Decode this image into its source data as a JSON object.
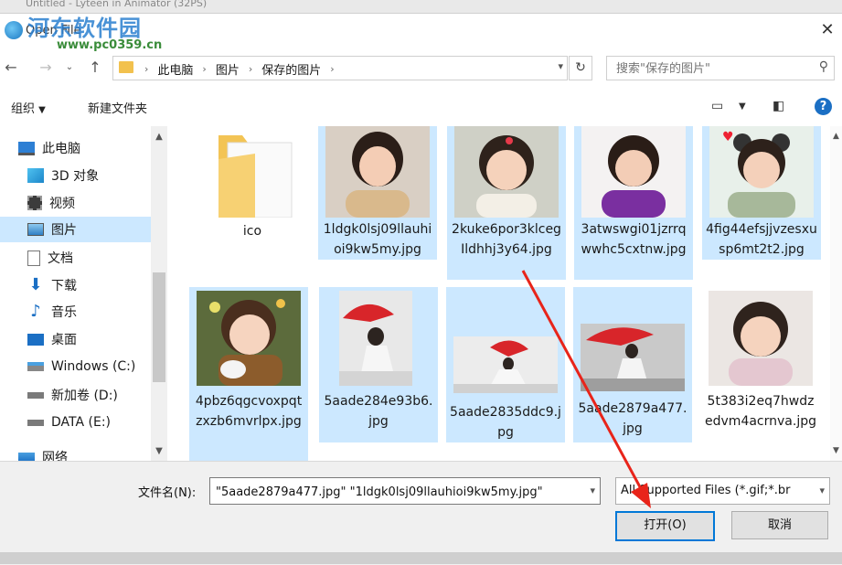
{
  "window": {
    "background_title": "Untitled - Lyteen in Animator (32PS)",
    "dialog_title": "Open File",
    "watermark": "河东软件园",
    "watermark_url": "www.pc0359.cn"
  },
  "address": {
    "crumbs": [
      "此电脑",
      "图片",
      "保存的图片"
    ],
    "search_placeholder": "搜索\"保存的图片\""
  },
  "toolbar": {
    "organize": "组织",
    "new_folder": "新建文件夹"
  },
  "sidebar": {
    "items": [
      {
        "label": "此电脑",
        "icon": "computer-icon"
      },
      {
        "label": "3D 对象",
        "icon": "cube-icon"
      },
      {
        "label": "视频",
        "icon": "video-icon"
      },
      {
        "label": "图片",
        "icon": "picture-icon",
        "selected": true
      },
      {
        "label": "文档",
        "icon": "document-icon"
      },
      {
        "label": "下载",
        "icon": "download-icon"
      },
      {
        "label": "音乐",
        "icon": "music-icon"
      },
      {
        "label": "桌面",
        "icon": "desktop-icon"
      },
      {
        "label": "Windows (C:)",
        "icon": "drive-icon"
      },
      {
        "label": "新加卷 (D:)",
        "icon": "drive-icon"
      },
      {
        "label": "DATA (E:)",
        "icon": "drive-icon"
      },
      {
        "label": "网络",
        "icon": "network-icon"
      }
    ]
  },
  "files": [
    {
      "name": "ico",
      "kind": "folder",
      "selected": false
    },
    {
      "name": "1ldgk0lsj09llauhioi9kw5my.jpg",
      "kind": "portrait",
      "selected": true
    },
    {
      "name": "2kuke6por3klcegIldhhj3y64.jpg",
      "kind": "portrait",
      "selected": true
    },
    {
      "name": "3atwswgi01jzrrqwwhc5cxtnw.jpg",
      "kind": "portrait",
      "selected": true
    },
    {
      "name": "4fig44efsjjvzesxusp6mt2t2.jpg",
      "kind": "portrait",
      "selected": true
    },
    {
      "name": "4pbz6qgcvoxpqtzxzb6mvrlpx.jpg",
      "kind": "portrait",
      "selected": true
    },
    {
      "name": "5aade284e93b6.jpg",
      "kind": "umbrella",
      "selected": true
    },
    {
      "name": "5aade2835ddc9.jpg",
      "kind": "umbrella",
      "selected": true
    },
    {
      "name": "5aade2879a477.jpg",
      "kind": "umbrella",
      "selected": true
    },
    {
      "name": "5t383i2eq7hwdzedvm4acrnva.jpg",
      "kind": "portrait",
      "selected": false
    }
  ],
  "footer": {
    "filename_label": "文件名(N):",
    "filename_value": "\"5aade2879a477.jpg\" \"1ldgk0lsj09llauhioi9kw5my.jpg\"",
    "filter_value": "All Supported Files (*.gif;*.br",
    "open_button": "打开(O)",
    "cancel_button": "取消"
  },
  "colors": {
    "selection": "#cce8ff",
    "accent": "#0078d7",
    "annotation_arrow": "#e8241a"
  }
}
